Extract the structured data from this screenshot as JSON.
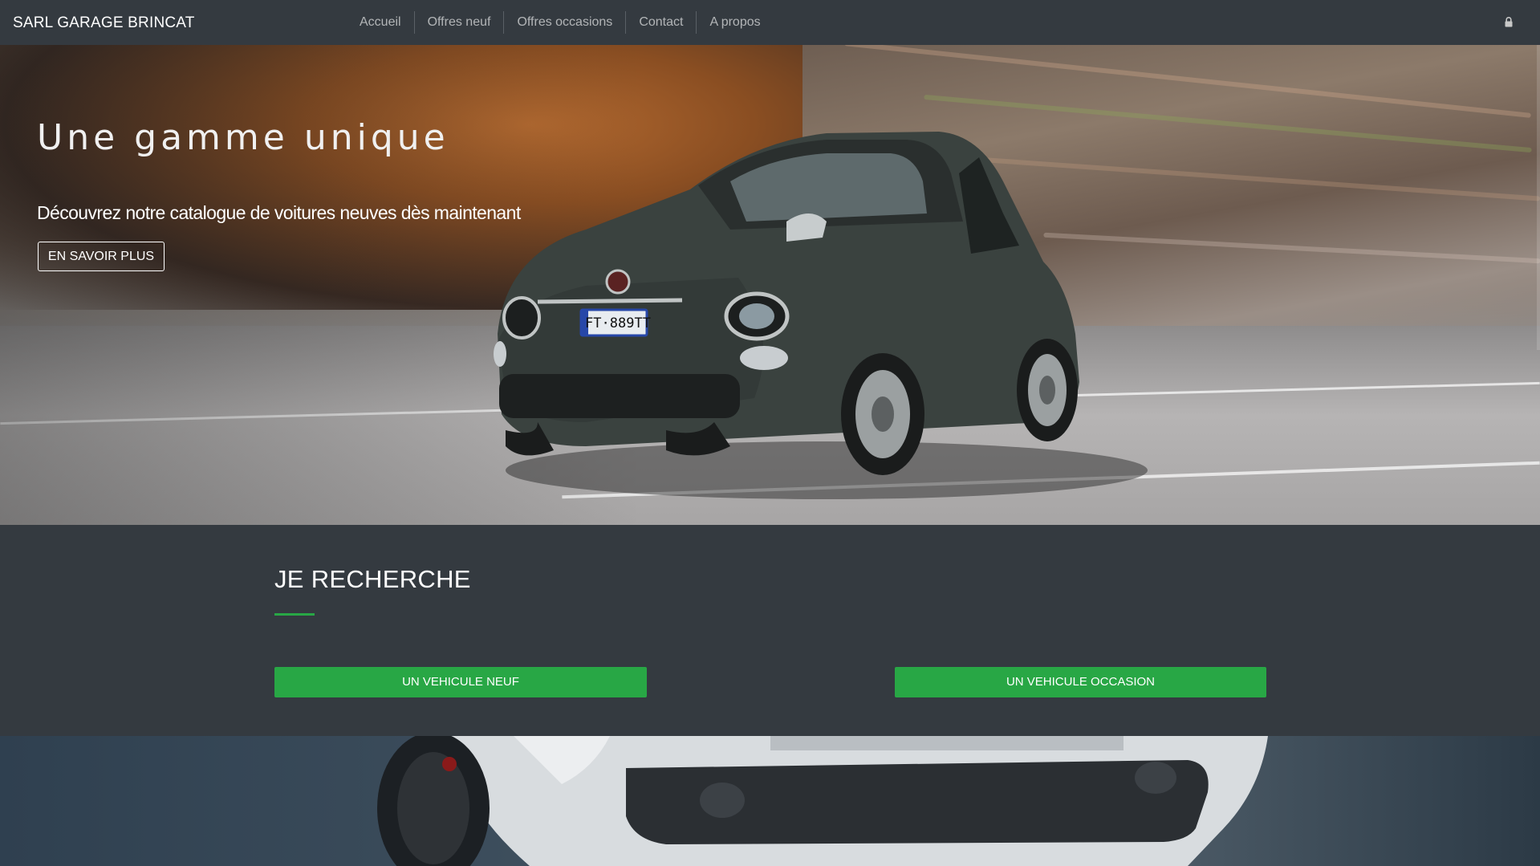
{
  "navbar": {
    "brand": "SARL GARAGE BRINCAT",
    "items": [
      {
        "label": "Accueil"
      },
      {
        "label": "Offres neuf"
      },
      {
        "label": "Offres occasions"
      },
      {
        "label": "Contact"
      },
      {
        "label": "A propos"
      }
    ],
    "icon": "lock-icon"
  },
  "hero": {
    "title": "Une gamme unique",
    "subtitle": "Découvrez notre catalogue de voitures neuves dès maintenant",
    "button_label": "EN SAVOIR PLUS",
    "plate": "FT·889TT"
  },
  "search": {
    "title": "JE RECHERCHE",
    "buttons": [
      {
        "label": "UN VEHICULE NEUF"
      },
      {
        "label": "UN VEHICULE OCCASION"
      }
    ]
  },
  "colors": {
    "navbar_bg": "#343a40",
    "accent_green": "#28a745",
    "text_white": "#ffffff",
    "nav_text": "rgba(255,255,255,0.62)"
  }
}
